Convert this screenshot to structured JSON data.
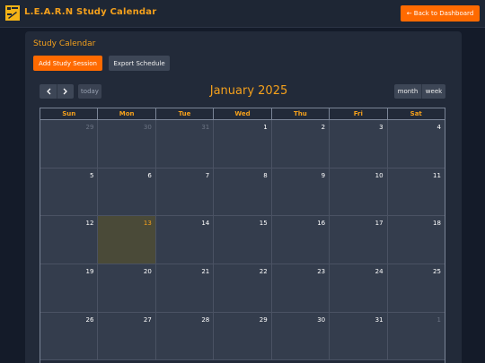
{
  "header": {
    "brand": "L.E.A.R.N Study Calendar",
    "back_button": "← Back to Dashboard"
  },
  "card": {
    "title": "Study Calendar",
    "add_button": "Add Study Session",
    "export_button": "Export Schedule"
  },
  "toolbar": {
    "prev_icon": "chevron-left-icon",
    "next_icon": "chevron-right-icon",
    "today_label": "today",
    "title": "January 2025",
    "view_month": "month",
    "view_week": "week"
  },
  "calendar": {
    "weekdays": [
      "Sun",
      "Mon",
      "Tue",
      "Wed",
      "Thu",
      "Fri",
      "Sat"
    ],
    "today_index": 15,
    "weeks": [
      [
        {
          "n": "29",
          "other": true
        },
        {
          "n": "30",
          "other": true
        },
        {
          "n": "31",
          "other": true
        },
        {
          "n": "1"
        },
        {
          "n": "2"
        },
        {
          "n": "3"
        },
        {
          "n": "4"
        }
      ],
      [
        {
          "n": "5"
        },
        {
          "n": "6"
        },
        {
          "n": "7"
        },
        {
          "n": "8"
        },
        {
          "n": "9"
        },
        {
          "n": "10"
        },
        {
          "n": "11"
        }
      ],
      [
        {
          "n": "12"
        },
        {
          "n": "13",
          "today": true
        },
        {
          "n": "14"
        },
        {
          "n": "15"
        },
        {
          "n": "16"
        },
        {
          "n": "17"
        },
        {
          "n": "18"
        }
      ],
      [
        {
          "n": "19"
        },
        {
          "n": "20"
        },
        {
          "n": "21"
        },
        {
          "n": "22"
        },
        {
          "n": "23"
        },
        {
          "n": "24"
        },
        {
          "n": "25"
        }
      ],
      [
        {
          "n": "26"
        },
        {
          "n": "27"
        },
        {
          "n": "28"
        },
        {
          "n": "29"
        },
        {
          "n": "30"
        },
        {
          "n": "31"
        },
        {
          "n": "1",
          "other": true
        }
      ]
    ]
  },
  "colors": {
    "accent": "#f4a01c",
    "primary_button": "#ff6a00",
    "background": "#141b29",
    "card": "#222a39",
    "cell": "#343d4d",
    "today_cell": "#4a4a38"
  }
}
